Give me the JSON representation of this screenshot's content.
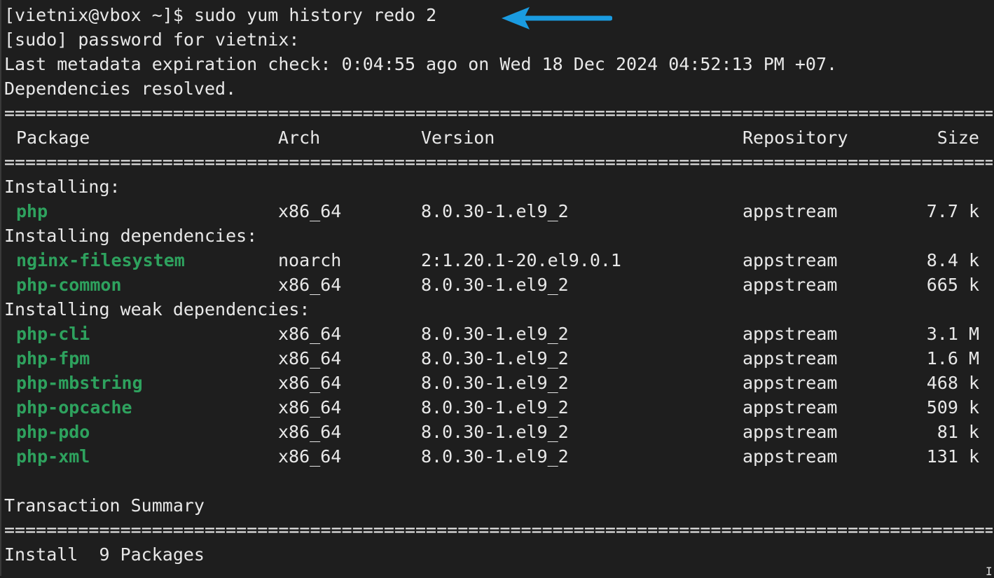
{
  "terminal": {
    "prompt": "[vietnix@vbox ~]$ ",
    "command": "sudo yum history redo 2",
    "output_lines": [
      "[sudo] password for vietnix:",
      "Last metadata expiration check: 0:04:55 ago on Wed 18 Dec 2024 04:52:13 PM +07.",
      "Dependencies resolved."
    ],
    "separator": "================================================================================================================================"
  },
  "table": {
    "headers": {
      "package": "Package",
      "arch": "Arch",
      "version": "Version",
      "repository": "Repository",
      "size": "Size"
    },
    "groups": [
      {
        "label": "Installing:",
        "rows": [
          {
            "package": "php",
            "arch": "x86_64",
            "version": "8.0.30-1.el9_2",
            "repository": "appstream",
            "size": "7.7 k"
          }
        ]
      },
      {
        "label": "Installing dependencies:",
        "rows": [
          {
            "package": "nginx-filesystem",
            "arch": "noarch",
            "version": "2:1.20.1-20.el9.0.1",
            "repository": "appstream",
            "size": "8.4 k"
          },
          {
            "package": "php-common",
            "arch": "x86_64",
            "version": "8.0.30-1.el9_2",
            "repository": "appstream",
            "size": "665 k"
          }
        ]
      },
      {
        "label": "Installing weak dependencies:",
        "rows": [
          {
            "package": "php-cli",
            "arch": "x86_64",
            "version": "8.0.30-1.el9_2",
            "repository": "appstream",
            "size": "3.1 M"
          },
          {
            "package": "php-fpm",
            "arch": "x86_64",
            "version": "8.0.30-1.el9_2",
            "repository": "appstream",
            "size": "1.6 M"
          },
          {
            "package": "php-mbstring",
            "arch": "x86_64",
            "version": "8.0.30-1.el9_2",
            "repository": "appstream",
            "size": "468 k"
          },
          {
            "package": "php-opcache",
            "arch": "x86_64",
            "version": "8.0.30-1.el9_2",
            "repository": "appstream",
            "size": "509 k"
          },
          {
            "package": "php-pdo",
            "arch": "x86_64",
            "version": "8.0.30-1.el9_2",
            "repository": "appstream",
            "size": "81 k"
          },
          {
            "package": "php-xml",
            "arch": "x86_64",
            "version": "8.0.30-1.el9_2",
            "repository": "appstream",
            "size": "131 k"
          }
        ]
      }
    ]
  },
  "summary": {
    "title": "Transaction Summary",
    "install_line": "Install  9 Packages"
  },
  "colors": {
    "background": "#1e1e1e",
    "text": "#e8e8e8",
    "package_name": "#2ea25e",
    "arrow": "#1a9be0"
  },
  "icons": {
    "annotation": "left-arrow-icon",
    "cursor": "text-cursor-icon"
  }
}
